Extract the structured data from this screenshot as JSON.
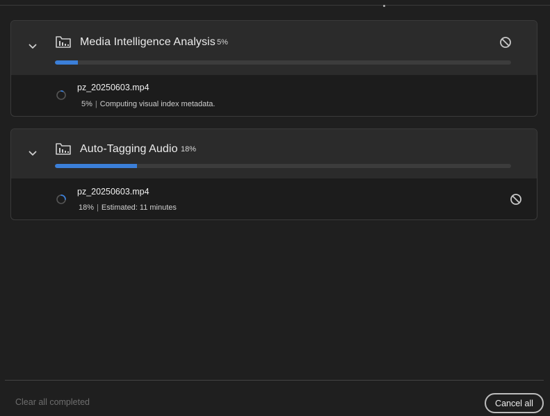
{
  "jobs": [
    {
      "title": "Media Intelligence Analysis",
      "percent_label": "5%",
      "progress": 0.05,
      "item": {
        "filename": "pz_20250603.mp4",
        "percent_label": "5%",
        "separator": "|",
        "status_text": "Computing visual index metadata."
      }
    },
    {
      "title": "Auto-Tagging Audio",
      "percent_label": "18%",
      "progress": 0.18,
      "item": {
        "filename": "pz_20250603.mp4",
        "percent_label": "18%",
        "separator": "|",
        "status_text": "Estimated: 11 minutes"
      }
    }
  ],
  "footer": {
    "clear_label": "Clear all completed",
    "cancel_all_label": "Cancel all"
  },
  "colors": {
    "progress_fill": "#3b7fd9",
    "background": "#1f1f1f",
    "header_background": "#2b2b2b"
  },
  "icons": {
    "expand": "chevron-down-icon",
    "job_folder": "folder-icon",
    "cancel": "cancel-icon",
    "item_progress": "spinner-icon"
  }
}
